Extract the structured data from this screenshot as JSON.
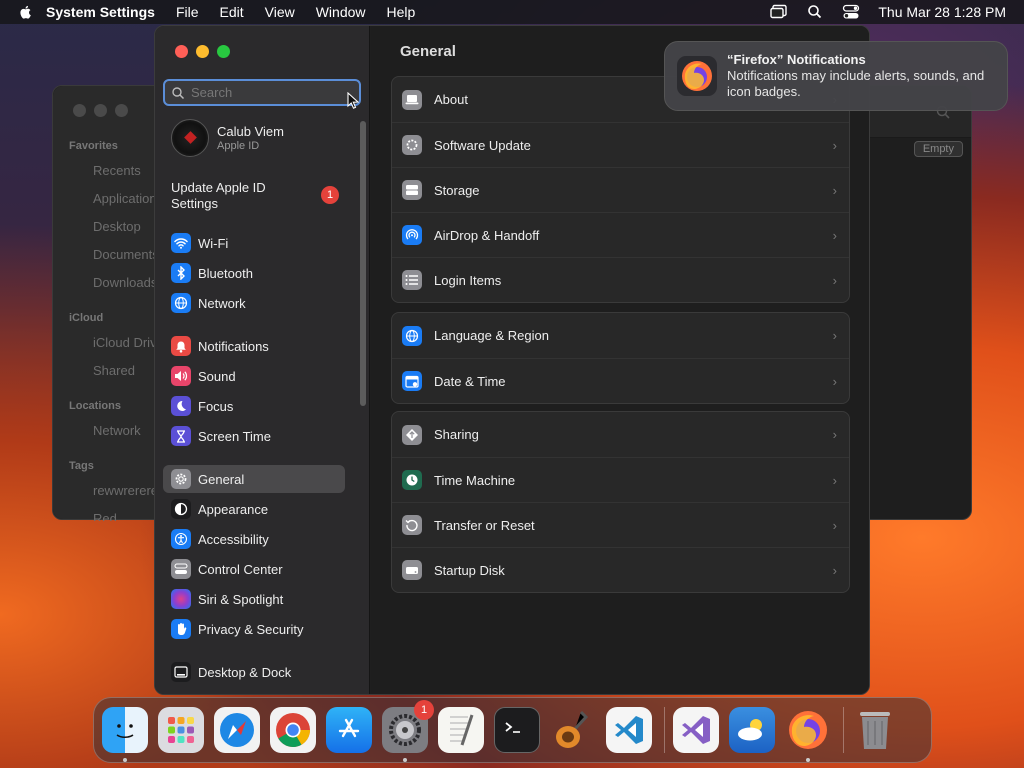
{
  "menubar": {
    "app_name": "System Settings",
    "menus": [
      "File",
      "Edit",
      "View",
      "Window",
      "Help"
    ],
    "clock": "Thu Mar 28  1:28 PM"
  },
  "finder": {
    "favorites_label": "Favorites",
    "favorites": [
      "Recents",
      "Applications",
      "Desktop",
      "Documents",
      "Downloads"
    ],
    "icloud_label": "iCloud",
    "icloud": [
      "iCloud Drive",
      "Shared"
    ],
    "locations_label": "Locations",
    "locations": [
      "Network"
    ],
    "tags_label": "Tags",
    "tags": [
      "rewwrerere",
      "Red"
    ],
    "empty_button": "Empty"
  },
  "settings": {
    "search_placeholder": "Search",
    "profile": {
      "name": "Calub Viem",
      "subtitle": "Apple ID"
    },
    "update": {
      "label": "Update Apple ID Settings",
      "badge": "1"
    },
    "sidebar": [
      {
        "label": "Wi-Fi",
        "icon": "wifi-icon",
        "color": "#1a7cf5"
      },
      {
        "label": "Bluetooth",
        "icon": "bluetooth-icon",
        "color": "#1a7cf5"
      },
      {
        "label": "Network",
        "icon": "globe-icon",
        "color": "#1a7cf5"
      },
      {
        "label": "Notifications",
        "icon": "bell-icon",
        "color": "#ea4a44"
      },
      {
        "label": "Sound",
        "icon": "speaker-icon",
        "color": "#e8456a"
      },
      {
        "label": "Focus",
        "icon": "moon-icon",
        "color": "#5b50d6"
      },
      {
        "label": "Screen Time",
        "icon": "hourglass-icon",
        "color": "#5b50d6"
      },
      {
        "label": "General",
        "icon": "gear-icon",
        "color": "#8e8e93"
      },
      {
        "label": "Appearance",
        "icon": "appearance-icon",
        "color": "#1c1c1e"
      },
      {
        "label": "Accessibility",
        "icon": "accessibility-icon",
        "color": "#1a7cf5"
      },
      {
        "label": "Control Center",
        "icon": "control-center-icon",
        "color": "#8e8e93"
      },
      {
        "label": "Siri & Spotlight",
        "icon": "siri-icon",
        "color": "#8a3fd1"
      },
      {
        "label": "Privacy & Security",
        "icon": "hand-icon",
        "color": "#1a7cf5"
      },
      {
        "label": "Desktop & Dock",
        "icon": "dock-icon",
        "color": "#1c1c1e"
      }
    ],
    "selected": "General",
    "title": "General",
    "groups": [
      [
        {
          "label": "About",
          "icon": "laptop-icon"
        },
        {
          "label": "Software Update",
          "icon": "gear-badge-icon"
        },
        {
          "label": "Storage",
          "icon": "storage-icon"
        },
        {
          "label": "AirDrop & Handoff",
          "icon": "airdrop-icon"
        },
        {
          "label": "Login Items",
          "icon": "list-icon"
        }
      ],
      [
        {
          "label": "Language & Region",
          "icon": "globe-icon"
        },
        {
          "label": "Date & Time",
          "icon": "calendar-icon"
        }
      ],
      [
        {
          "label": "Sharing",
          "icon": "sharing-icon"
        },
        {
          "label": "Time Machine",
          "icon": "time-machine-icon"
        },
        {
          "label": "Transfer or Reset",
          "icon": "reset-icon"
        },
        {
          "label": "Startup Disk",
          "icon": "disk-icon"
        }
      ]
    ]
  },
  "notification": {
    "title": "“Firefox” Notifications",
    "body": "Notifications may include alerts, sounds, and icon badges."
  },
  "dock": {
    "apps": [
      {
        "name": "finder",
        "running": true
      },
      {
        "name": "launchpad",
        "running": false
      },
      {
        "name": "safari",
        "running": false
      },
      {
        "name": "chrome",
        "running": false
      },
      {
        "name": "app-store",
        "running": false
      },
      {
        "name": "system-settings",
        "running": true,
        "badge": "1"
      },
      {
        "name": "textedit",
        "running": false
      },
      {
        "name": "terminal",
        "running": false
      },
      {
        "name": "garageband",
        "running": false
      },
      {
        "name": "vscode",
        "running": false
      },
      {
        "name": "visual-studio",
        "running": false
      },
      {
        "name": "weather",
        "running": false
      },
      {
        "name": "firefox",
        "running": true
      },
      {
        "name": "trash",
        "running": false
      }
    ]
  }
}
